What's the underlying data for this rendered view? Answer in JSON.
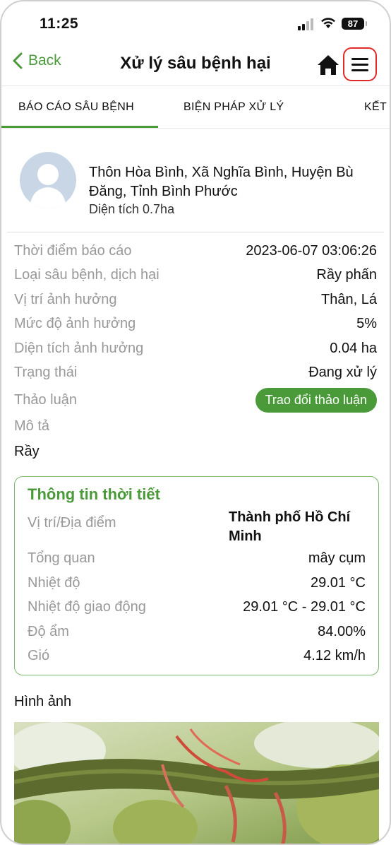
{
  "status_bar": {
    "time": "11:25",
    "battery": "87"
  },
  "nav": {
    "back_label": "Back",
    "title": "Xử lý sâu bệnh hại"
  },
  "tabs": [
    {
      "label": "BÁO CÁO SÂU BỆNH",
      "active": true
    },
    {
      "label": "BIỆN PHÁP XỬ LÝ",
      "active": false
    },
    {
      "label": "KẾT",
      "active": false
    }
  ],
  "profile": {
    "address": "Thôn Hòa Bình, Xã Nghĩa Bình, Huyện Bù Đăng, Tỉnh Bình Phước",
    "area": "Diện tích 0.7ha"
  },
  "report": {
    "time_label": "Thời điểm báo cáo",
    "time_value": "2023-06-07 03:06:26",
    "pest_label": "Loại sâu bệnh, dịch hại",
    "pest_value": "Rầy phấn",
    "position_label": "Vị trí ảnh hưởng",
    "position_value": "Thân, Lá",
    "severity_label": "Mức độ ảnh hưởng",
    "severity_value": "5%",
    "affected_area_label": "Diện tích ảnh hưởng",
    "affected_area_value": "0.04 ha",
    "status_label": "Trạng thái",
    "status_value": "Đang xử lý",
    "discussion_label": "Thảo luận",
    "discussion_button": "Trao đổi thảo luận",
    "description_label": "Mô tả",
    "description_value": "Rầy"
  },
  "weather": {
    "title": "Thông tin thời tiết",
    "location_label": "Vị trí/Địa điểm",
    "location_value": "Thành phố Hồ Chí Minh",
    "overview_label": "Tổng quan",
    "overview_value": "mây cụm",
    "temp_label": "Nhiệt độ",
    "temp_value": "29.01 °C",
    "temp_range_label": "Nhiệt độ giao động",
    "temp_range_value": "29.01 °C - 29.01 °C",
    "humidity_label": "Độ ẩm",
    "humidity_value": "84.00%",
    "wind_label": "Gió",
    "wind_value": "4.12 km/h"
  },
  "images": {
    "label": "Hình ảnh"
  },
  "colors": {
    "accent": "#4a9a3a",
    "highlight_border": "#e02a2a",
    "muted_text": "#999999"
  }
}
